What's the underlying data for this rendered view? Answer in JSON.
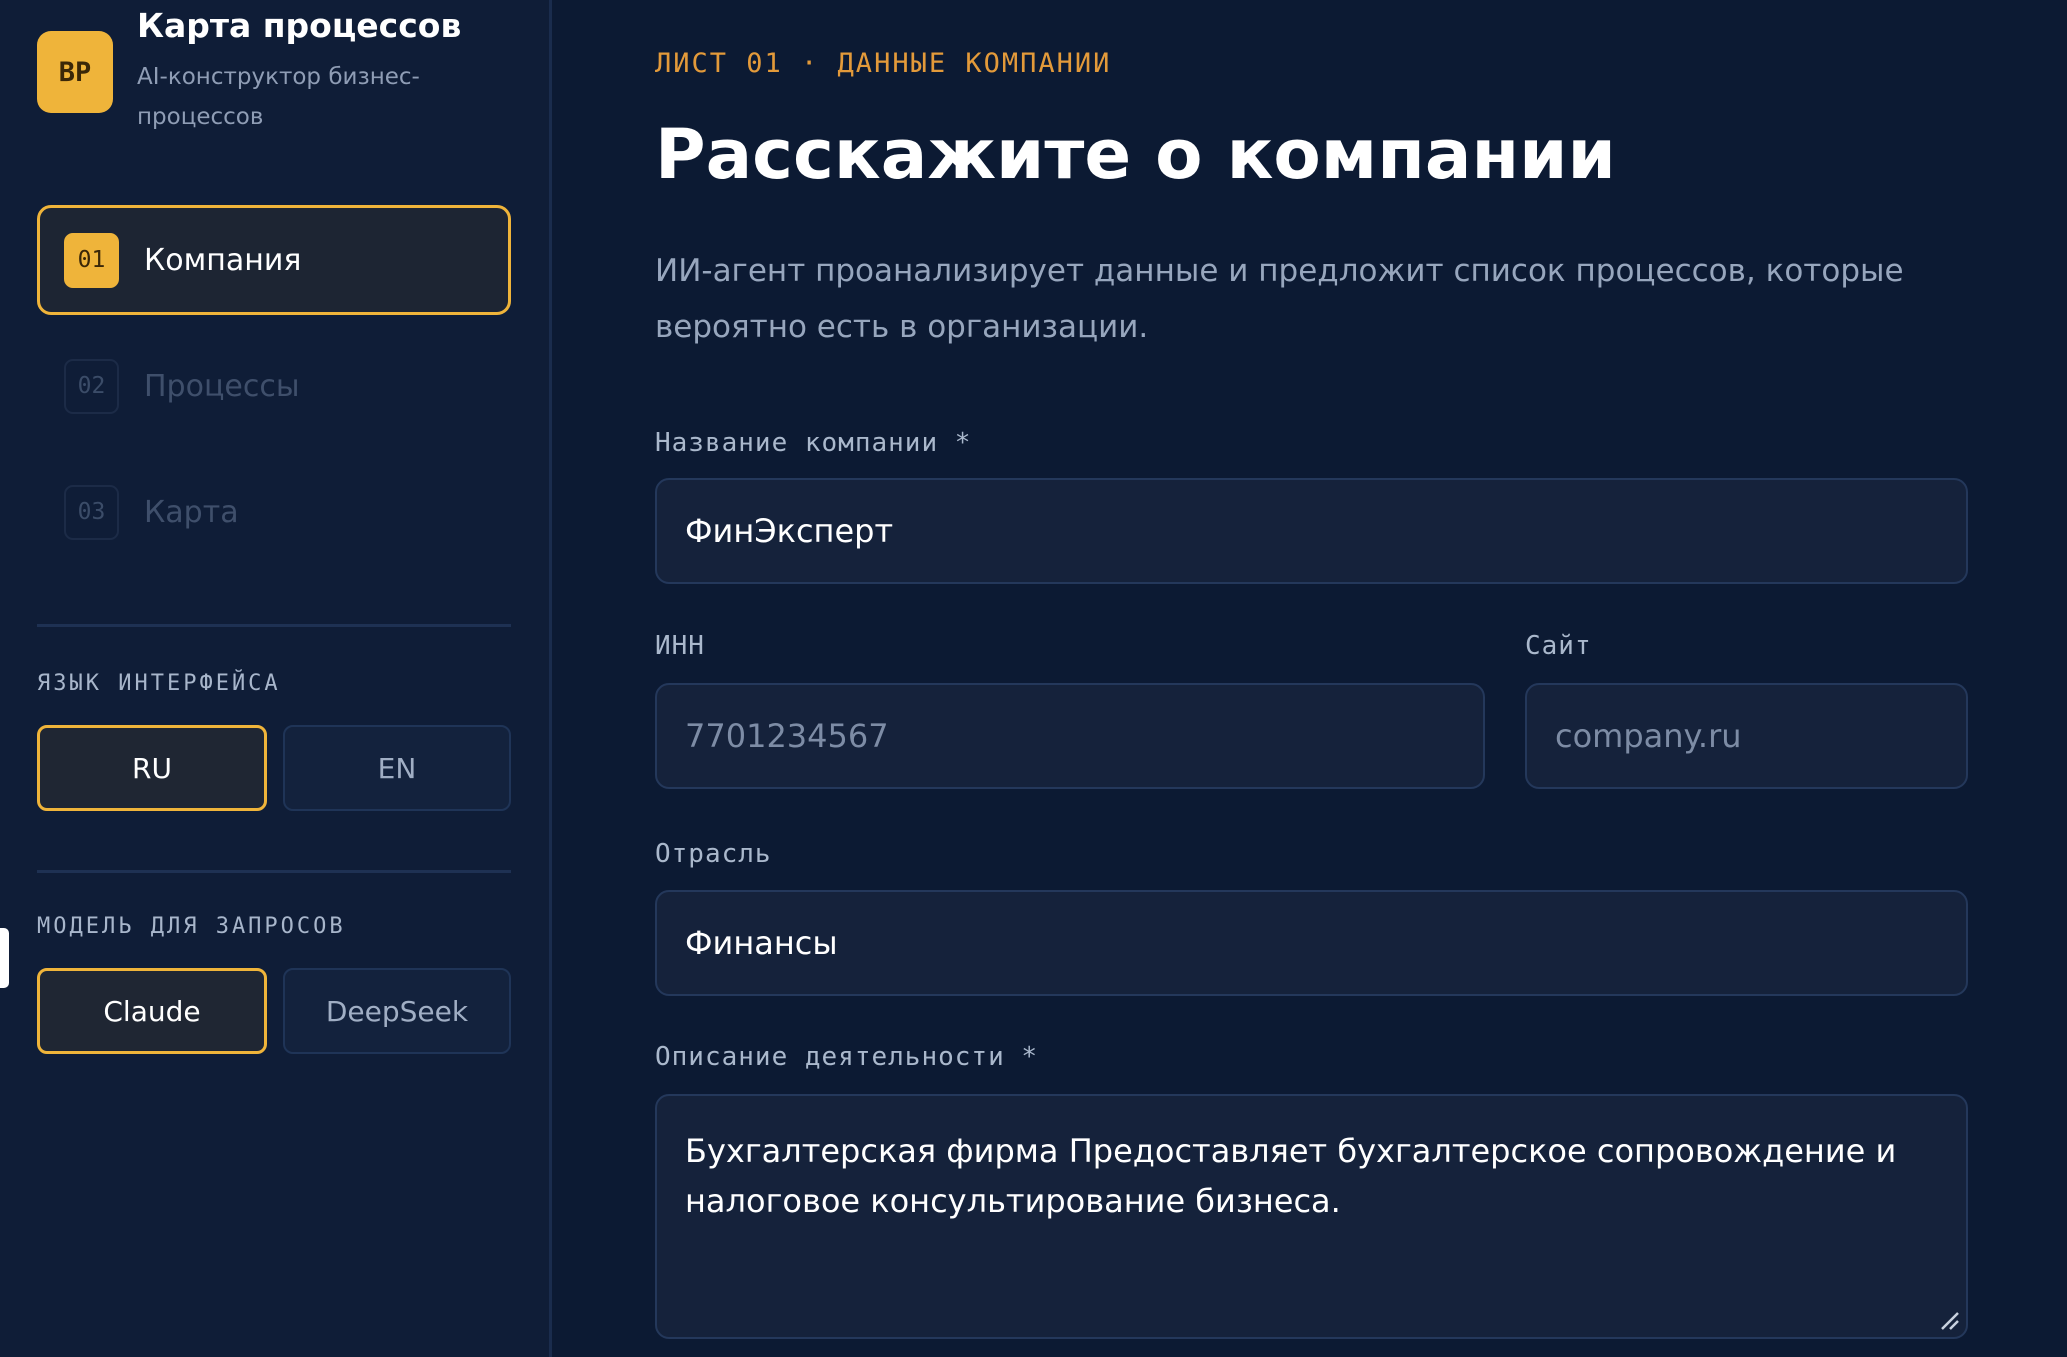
{
  "app": {
    "logo_text": "BP",
    "title": "Карта процессов",
    "subtitle": "AI-конструктор бизнес-процессов"
  },
  "steps": [
    {
      "num": "01",
      "label": "Компания",
      "active": true
    },
    {
      "num": "02",
      "label": "Процессы",
      "active": false
    },
    {
      "num": "03",
      "label": "Карта",
      "active": false
    }
  ],
  "language": {
    "label": "ЯЗЫК ИНТЕРФЕЙСА",
    "options": [
      "RU",
      "EN"
    ],
    "selected": "RU"
  },
  "model": {
    "label": "МОДЕЛЬ ДЛЯ ЗАПРОСОВ",
    "options": [
      "Claude",
      "DeepSeek"
    ],
    "selected": "Claude"
  },
  "main": {
    "eyebrow": "ЛИСТ 01 · ДАННЫЕ КОМПАНИИ",
    "title": "Расскажите о компании",
    "intro": "ИИ-агент проанализирует данные и предложит список процессов, которые вероятно есть в организации."
  },
  "form": {
    "company_label": "Название компании *",
    "company_value": "ФинЭксперт",
    "inn_label": "ИНН",
    "inn_placeholder": "7701234567",
    "site_label": "Сайт",
    "site_placeholder": "company.ru",
    "industry_label": "Отрасль",
    "industry_value": "Финансы",
    "description_label": "Описание деятельности *",
    "description_value": "Бухгалтерская фирма Предоставляет бухгалтерское сопровождение и налоговое консультирование бизнеса."
  },
  "colors": {
    "accent": "#efb43a",
    "eyebrow": "#e39a3a",
    "background": "#0c1a33",
    "sidebar": "#0f1d37"
  }
}
